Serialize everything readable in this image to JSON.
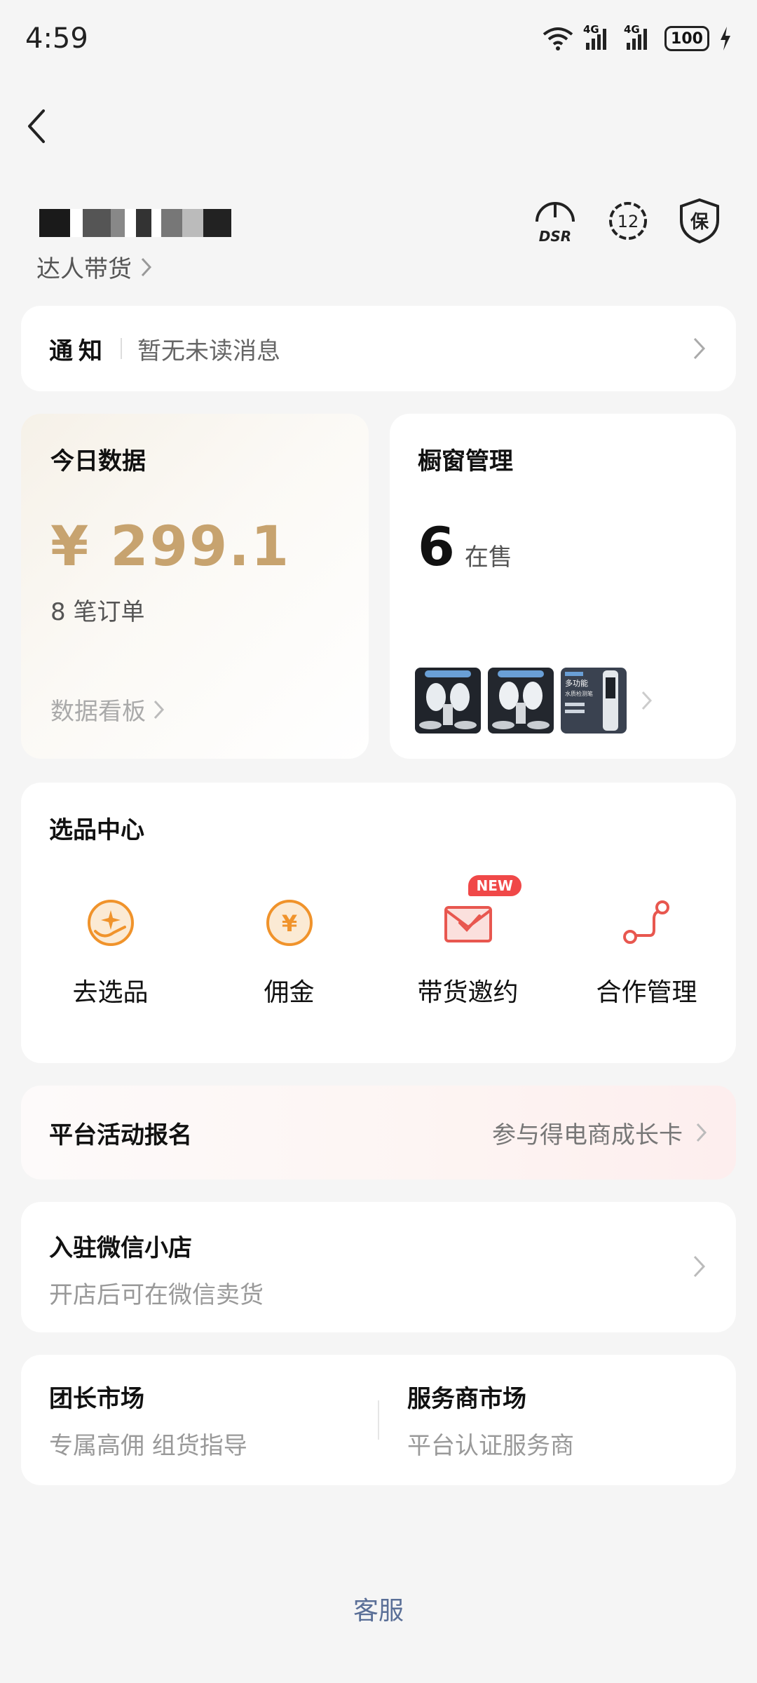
{
  "status_bar": {
    "time": "4:59",
    "net1": "4G",
    "net2": "4G",
    "battery": "100"
  },
  "header": {
    "shop_sub": "达人带货",
    "icons": [
      "dsr-icon",
      "badge-12-icon",
      "shield-bao-icon"
    ],
    "dsr_label": "DSR",
    "badge_num": "12",
    "bao_label": "保"
  },
  "notice": {
    "title": "通知",
    "text": "暂无未读消息"
  },
  "today": {
    "title": "今日数据",
    "amount": "¥ 299.1",
    "orders": "8 笔订单",
    "link": "数据看板"
  },
  "window": {
    "title": "橱窗管理",
    "count": "6",
    "count_label": "在售",
    "thumb_caption": "多功能",
    "thumb_caption2": "水质检测笔"
  },
  "selection": {
    "title": "选品中心",
    "items": [
      {
        "label": "去选品"
      },
      {
        "label": "佣金",
        "symbol": "¥"
      },
      {
        "label": "带货邀约",
        "badge": "NEW"
      },
      {
        "label": "合作管理"
      }
    ]
  },
  "activity": {
    "title": "平台活动报名",
    "right": "参与得电商成长卡"
  },
  "wechat": {
    "title": "入驻微信小店",
    "sub": "开店后可在微信卖货"
  },
  "markets": [
    {
      "title": "团长市场",
      "sub": "专属高佣 组货指导"
    },
    {
      "title": "服务商市场",
      "sub": "平台认证服务商"
    }
  ],
  "footer": {
    "service": "客服"
  },
  "colors": {
    "gold": "#c7a36f",
    "orange": "#f0932b",
    "red": "#f04848",
    "link_blue": "#5a6f97"
  }
}
